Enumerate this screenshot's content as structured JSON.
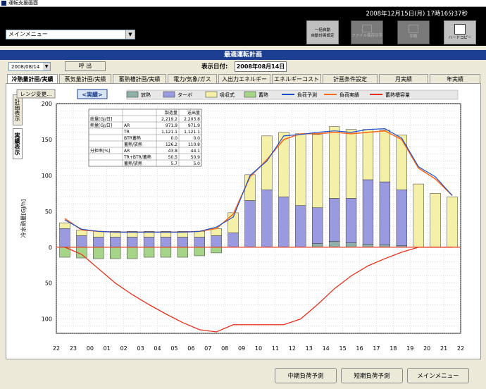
{
  "window": {
    "title": "運転支援画面"
  },
  "header": {
    "datetime": "2008年12月15日(月) 17時16分37秒",
    "menu_select": "メインメニュー",
    "tool_buttons": [
      {
        "label": "一括自動\n自動計画設定",
        "state": "active"
      },
      {
        "label": "ファイル保存印字",
        "state": "disabled"
      },
      {
        "label": "印刷",
        "state": "disabled"
      },
      {
        "label": "ハードコピー",
        "state": "active"
      }
    ]
  },
  "banner": "最適運転計画",
  "date_input": "2008/08/14",
  "call_button": "呼 出",
  "display_date_label": "表示日付:",
  "display_date_value": "2008年08月14日",
  "tabs": [
    "冷熱量計画/実績",
    "蒸気量計画/実績",
    "蓄熱槽計画/実績",
    "電力/気象/ガス",
    "入出力エネルギー",
    "エネルギーコスト",
    "計画条件設定",
    "月実績",
    "年実績"
  ],
  "side_tabs": [
    "計画表示",
    "実績表示"
  ],
  "legend_change_button": "レンジ変更...",
  "mode_label": "<実績>",
  "bottom_buttons": [
    "中期負荷予測",
    "短期負荷予測",
    "メインメニュー"
  ],
  "summary_table": {
    "headers": [
      "",
      "",
      "製造量",
      "送出量"
    ],
    "rows": [
      [
        "総量[GJ/日]",
        "",
        "2,219.2",
        "2,203.8"
      ],
      [
        "熱量[GJ/日]",
        "AR",
        "971.9",
        "971.9"
      ],
      [
        "",
        "TR",
        "1,121.1",
        "1,121.1"
      ],
      [
        "",
        "BTR蓄熱",
        "0.0",
        "0.0"
      ],
      [
        "",
        "蓄熱/放熱",
        "126.2",
        "110.8"
      ],
      [
        "分担率[%]",
        "AR",
        "43.8",
        "44.1"
      ],
      [
        "",
        "TR+BTR/蓄熱",
        "50.5",
        "50.9"
      ],
      [
        "",
        "蓄熱/放熱",
        "5.7",
        "5.0"
      ]
    ]
  },
  "chart_data": {
    "type": "bar",
    "ylabel": "冷水熱量[GJ/h]",
    "ylim": [
      -120,
      200
    ],
    "yticks": [
      200,
      150,
      100,
      50,
      0,
      50,
      100
    ],
    "categories": [
      "22",
      "23",
      "00",
      "01",
      "02",
      "03",
      "04",
      "05",
      "06",
      "07",
      "08",
      "09",
      "10",
      "11",
      "12",
      "13",
      "14",
      "15",
      "16",
      "17",
      "18",
      "19",
      "20",
      "21"
    ],
    "x_tick_labels": [
      "22",
      "23",
      "00",
      "01",
      "02",
      "03",
      "04",
      "05",
      "06",
      "07",
      "08",
      "09",
      "10",
      "11",
      "12",
      "13",
      "14",
      "15",
      "16",
      "17",
      "18",
      "19",
      "20",
      "21",
      "22"
    ],
    "legend": [
      "放熱",
      "ターボ",
      "吸収式",
      "蓄熱",
      "負荷予測",
      "負荷実績",
      "蓄熱槽容量"
    ],
    "colors": {
      "release": "#8fb0a8",
      "turbo": "#9a9ae0",
      "absorb": "#f5f0a8",
      "storage": "#a6d58a",
      "forecast": "#1a4fd0",
      "actual": "#ff6a1a",
      "capacity": "#e8301a"
    },
    "series": [
      {
        "name": "放熱",
        "values": [
          0,
          0,
          0,
          0,
          0,
          0,
          0,
          0,
          0,
          0,
          0,
          0,
          0,
          0,
          0,
          5,
          8,
          6,
          4,
          3,
          2,
          0,
          0,
          0
        ]
      },
      {
        "name": "ターボ",
        "values": [
          26,
          16,
          14,
          14,
          14,
          14,
          14,
          14,
          14,
          16,
          20,
          65,
          80,
          70,
          58,
          50,
          60,
          62,
          90,
          88,
          78,
          0,
          0,
          0
        ]
      },
      {
        "name": "吸収式",
        "values": [
          8,
          8,
          8,
          8,
          8,
          8,
          8,
          8,
          8,
          10,
          28,
          36,
          75,
          90,
          100,
          102,
          100,
          96,
          70,
          72,
          76,
          88,
          75,
          70
        ]
      },
      {
        "name": "蓄熱",
        "values": [
          -14,
          -15,
          -16,
          -16,
          -16,
          -14,
          -14,
          -14,
          -12,
          -8,
          0,
          0,
          0,
          0,
          0,
          0,
          0,
          0,
          0,
          0,
          0,
          0,
          0,
          0
        ]
      }
    ],
    "forecast": [
      38,
      25,
      22,
      21,
      21,
      21,
      21,
      21,
      22,
      28,
      42,
      100,
      120,
      155,
      157,
      160,
      162,
      160,
      164,
      165,
      152,
      112,
      98,
      72
    ],
    "actual": [
      40,
      24,
      22,
      21,
      21,
      21,
      21,
      21,
      22,
      26,
      46,
      98,
      122,
      150,
      158,
      158,
      160,
      158,
      160,
      162,
      150,
      110,
      95,
      72
    ],
    "capacity": [
      0,
      -10,
      -30,
      -50,
      -66,
      -80,
      -93,
      -105,
      -115,
      -118,
      -108,
      -108,
      -108,
      -108,
      -100,
      -80,
      -58,
      -40,
      -26,
      -16,
      -7,
      0,
      0,
      0
    ]
  }
}
